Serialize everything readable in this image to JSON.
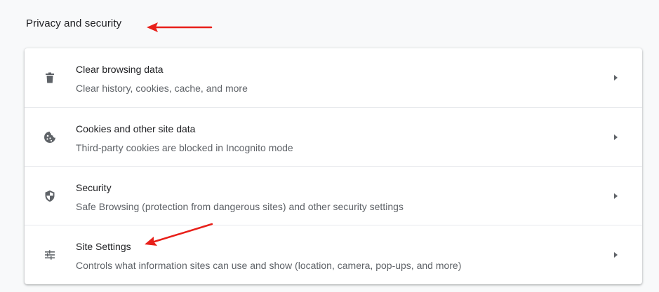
{
  "section": {
    "title": "Privacy and security"
  },
  "rows": [
    {
      "label": "Clear browsing data",
      "sublabel": "Clear history, cookies, cache, and more",
      "icon": "trash-icon"
    },
    {
      "label": "Cookies and other site data",
      "sublabel": "Third-party cookies are blocked in Incognito mode",
      "icon": "cookie-icon"
    },
    {
      "label": "Security",
      "sublabel": "Safe Browsing (protection from dangerous sites) and other security settings",
      "icon": "shield-icon"
    },
    {
      "label": "Site Settings",
      "sublabel": "Controls what information sites can use and show (location, camera, pop-ups, and more)",
      "icon": "tune-sliders-icon"
    }
  ],
  "colors": {
    "background": "#f8f9fa",
    "card": "#ffffff",
    "text_primary": "#202124",
    "text_secondary": "#5f6368",
    "icon": "#5f6368",
    "annotation_arrow": "#e8201a"
  }
}
